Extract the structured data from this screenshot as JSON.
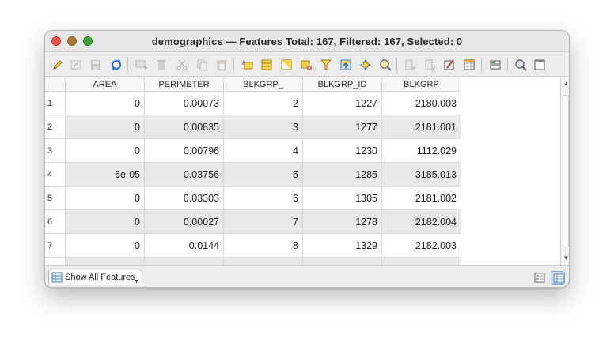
{
  "window": {
    "title": "demographics — Features Total: 167, Filtered: 167, Selected: 0"
  },
  "table": {
    "columns": [
      "AREA",
      "PERIMETER",
      "BLKGRP_",
      "BLKGRP_ID",
      "BLKGRP"
    ],
    "rows": [
      {
        "num": "1",
        "cells": [
          "0",
          "0.00073",
          "2",
          "1227",
          "2180.003"
        ]
      },
      {
        "num": "2",
        "cells": [
          "0",
          "0.00835",
          "3",
          "1277",
          "2181.001"
        ]
      },
      {
        "num": "3",
        "cells": [
          "0",
          "0.00796",
          "4",
          "1230",
          "1112.029"
        ]
      },
      {
        "num": "4",
        "cells": [
          "6e-05",
          "0.03756",
          "5",
          "1285",
          "3185.013"
        ]
      },
      {
        "num": "5",
        "cells": [
          "0",
          "0.03303",
          "6",
          "1305",
          "2181.002"
        ]
      },
      {
        "num": "6",
        "cells": [
          "0",
          "0.00027",
          "7",
          "1278",
          "2182.004"
        ]
      },
      {
        "num": "7",
        "cells": [
          "0",
          "0.0144",
          "8",
          "1329",
          "2182.003"
        ]
      }
    ]
  },
  "bottom": {
    "filter_label": "Show All Features"
  },
  "icons": {
    "toolbar": [
      "pencil-icon",
      "multi-edit-icon",
      "save-icon",
      "reload-icon",
      "add-feature-icon",
      "delete-icon",
      "cut-icon",
      "copy-icon",
      "paste-icon",
      "select-expression-icon",
      "select-all-icon",
      "invert-selection-icon",
      "deselect-icon",
      "filter-icon",
      "move-to-top-icon",
      "pan-to-selected-icon",
      "zoom-to-selected-icon",
      "new-field-icon",
      "delete-field-icon",
      "field-calculator-icon",
      "conditional-formatting-icon",
      "actions-icon",
      "dock-icon",
      "organize-columns-icon"
    ],
    "colors": {
      "selected_view": "#cfe0f7",
      "row_alt": "#e9e9e9"
    }
  }
}
